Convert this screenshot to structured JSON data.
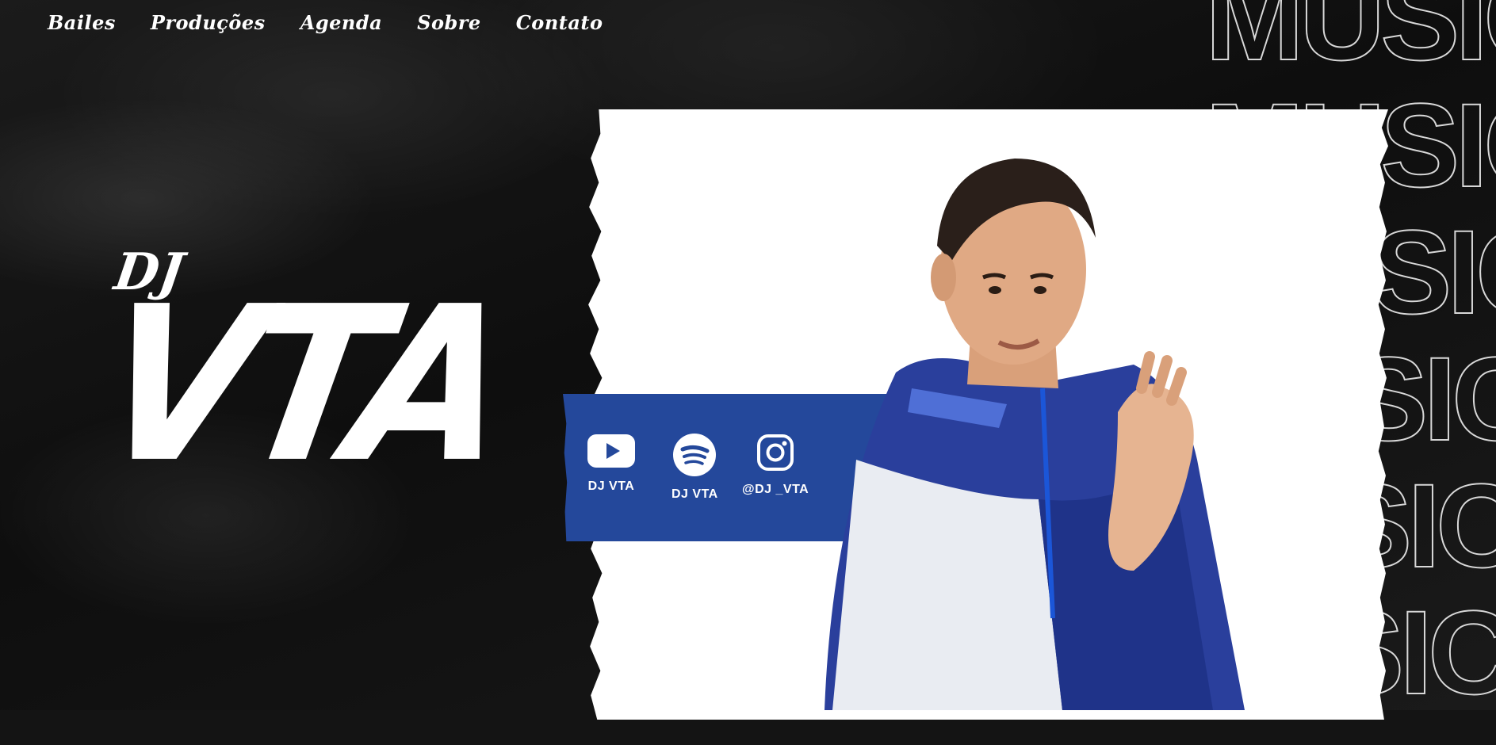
{
  "nav": {
    "items": [
      "Bailes",
      "Produções",
      "Agenda",
      "Sobre",
      "Contato"
    ]
  },
  "logo": {
    "line1": "DJ",
    "line2": "VTA"
  },
  "background_word": "MUSIC",
  "social": {
    "items": [
      {
        "icon": "youtube-icon",
        "label": "DJ  VTA"
      },
      {
        "icon": "spotify-icon",
        "label": "DJ  VTA"
      },
      {
        "icon": "instagram-icon",
        "label": "@DJ _VTA"
      }
    ]
  },
  "colors": {
    "background": "#141414",
    "accent_blue": "#24489b",
    "panel": "#ffffff",
    "text": "#ffffff"
  }
}
